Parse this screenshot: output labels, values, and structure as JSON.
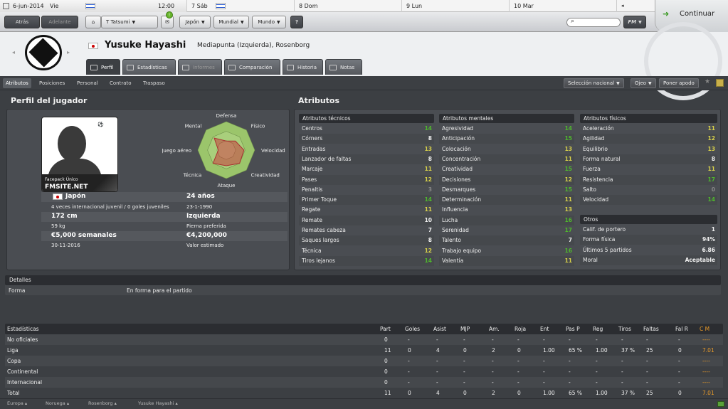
{
  "topbar": {
    "date": "6-jun-2014",
    "day": "Vie",
    "time": "12:00",
    "days": [
      "7 Sáb",
      "8 Dom",
      "9 Lun",
      "10 Mar"
    ]
  },
  "toolbar": {
    "back": "Atrás",
    "forward": "Adelante",
    "manager": "T Tatsumi",
    "japan": "Japón",
    "world_cup": "Mundial",
    "world": "Mundo",
    "help": "?",
    "continue": "Continuar",
    "fm_menu": "FM"
  },
  "player": {
    "name": "Yusuke Hayashi",
    "position_club": "Mediapunta (Izquierda), Rosenborg"
  },
  "tabs": [
    {
      "label": "Perfil",
      "state": "active"
    },
    {
      "label": "Estadísticas",
      "state": "normal"
    },
    {
      "label": "Informes",
      "state": "disabled"
    },
    {
      "label": "Comparación",
      "state": "normal"
    },
    {
      "label": "Historia",
      "state": "normal"
    },
    {
      "label": "Notas",
      "state": "normal"
    }
  ],
  "subnav": [
    "Atributos",
    "Posiciones",
    "Personal",
    "Contrato",
    "Traspaso"
  ],
  "actions": {
    "national": "Selección nacional",
    "scout": "Ojeo",
    "support": "Poner apodo"
  },
  "profile": {
    "title": "Perfil del jugador",
    "facepack_line1": "Facepack Único",
    "facepack_line2": "FMSITE.NET",
    "nation": "Japón",
    "intl": "4 veces internacional juvenil / 0 goles juveniles",
    "age": "24 años",
    "dob": "23-1-1990",
    "height": "172 cm",
    "weight": "59 kg",
    "foot": "Izquierda",
    "foot_label": "Pierna preferida",
    "wage": "€5,000 semanales",
    "contract_end": "30-11-2016",
    "value": "€4,200,000",
    "value_label": "Valor estimado",
    "radar_labels": [
      "Defensa",
      "Físico",
      "Velocidad",
      "Creatividad",
      "Ataque",
      "Técnica",
      "Juego aéreo",
      "Mental"
    ],
    "radar_values": [
      0.32,
      0.45,
      0.62,
      0.66,
      0.55,
      0.66,
      0.28,
      0.6
    ]
  },
  "attributes": {
    "title": "Atributos",
    "technical_header": "Atributos técnicos",
    "technical": [
      {
        "name": "Centros",
        "value": "14",
        "color": "green"
      },
      {
        "name": "Córners",
        "value": "8",
        "color": "white"
      },
      {
        "name": "Entradas",
        "value": "13",
        "color": "yellow"
      },
      {
        "name": "Lanzador de faltas",
        "value": "8",
        "color": "white"
      },
      {
        "name": "Marcaje",
        "value": "11",
        "color": "yellow"
      },
      {
        "name": "Pases",
        "value": "12",
        "color": "yellow"
      },
      {
        "name": "Penaltis",
        "value": "3",
        "color": "grey"
      },
      {
        "name": "Primer Toque",
        "value": "14",
        "color": "green"
      },
      {
        "name": "Regate",
        "value": "11",
        "color": "yellow"
      },
      {
        "name": "Remate",
        "value": "10",
        "color": "white"
      },
      {
        "name": "Remates cabeza",
        "value": "7",
        "color": "white"
      },
      {
        "name": "Saques largos",
        "value": "8",
        "color": "white"
      },
      {
        "name": "Técnica",
        "value": "12",
        "color": "yellow"
      },
      {
        "name": "Tiros lejanos",
        "value": "14",
        "color": "green"
      }
    ],
    "mental_header": "Atributos mentales",
    "mental": [
      {
        "name": "Agresividad",
        "value": "14",
        "color": "green"
      },
      {
        "name": "Anticipación",
        "value": "15",
        "color": "green"
      },
      {
        "name": "Colocación",
        "value": "13",
        "color": "yellow"
      },
      {
        "name": "Concentración",
        "value": "11",
        "color": "yellow"
      },
      {
        "name": "Creatividad",
        "value": "15",
        "color": "green"
      },
      {
        "name": "Decisiones",
        "value": "12",
        "color": "yellow"
      },
      {
        "name": "Desmarques",
        "value": "15",
        "color": "green"
      },
      {
        "name": "Determinación",
        "value": "11",
        "color": "yellow"
      },
      {
        "name": "Influencia",
        "value": "13",
        "color": "yellow"
      },
      {
        "name": "Lucha",
        "value": "16",
        "color": "green"
      },
      {
        "name": "Serenidad",
        "value": "17",
        "color": "green"
      },
      {
        "name": "Talento",
        "value": "7",
        "color": "white"
      },
      {
        "name": "Trabajo equipo",
        "value": "16",
        "color": "green"
      },
      {
        "name": "Valentía",
        "value": "11",
        "color": "yellow"
      }
    ],
    "physical_header": "Atributos físicos",
    "physical": [
      {
        "name": "Aceleración",
        "value": "11",
        "color": "yellow"
      },
      {
        "name": "Agilidad",
        "value": "12",
        "color": "yellow"
      },
      {
        "name": "Equilibrio",
        "value": "13",
        "color": "yellow"
      },
      {
        "name": "Forma natural",
        "value": "8",
        "color": "white"
      },
      {
        "name": "Fuerza",
        "value": "11",
        "color": "yellow"
      },
      {
        "name": "Resistencia",
        "value": "17",
        "color": "green"
      },
      {
        "name": "Salto",
        "value": "0",
        "color": "grey"
      },
      {
        "name": "Velocidad",
        "value": "14",
        "color": "green"
      }
    ],
    "other_header": "Otros",
    "other": [
      {
        "name": "Calif. de portero",
        "value": "1"
      },
      {
        "name": "Forma física",
        "value": "94%"
      },
      {
        "name": "Últimos 5 partidos",
        "value": "6.86"
      },
      {
        "name": "Moral",
        "value": "Aceptable"
      }
    ]
  },
  "details": {
    "title": "Detalles",
    "form_label": "Forma",
    "form_value": "En forma para el partido"
  },
  "stats": {
    "headers": [
      "Estadísticas",
      "Part",
      "Goles",
      "Asist",
      "MJP",
      "Am.",
      "Roja",
      "Ent",
      "Pas P",
      "Reg",
      "Tiros",
      "Faltas",
      "Fal R",
      "C M"
    ],
    "rows": [
      [
        "No oficiales",
        "0",
        "-",
        "-",
        "-",
        "-",
        "-",
        "-",
        "-",
        "-",
        "-",
        "-",
        "-",
        "----"
      ],
      [
        "Liga",
        "11",
        "0",
        "4",
        "0",
        "2",
        "0",
        "1.00",
        "65 %",
        "1.00",
        "37 %",
        "25",
        "0",
        "7.01"
      ],
      [
        "Copa",
        "0",
        "-",
        "-",
        "-",
        "-",
        "-",
        "-",
        "-",
        "-",
        "-",
        "-",
        "-",
        "----"
      ],
      [
        "Continental",
        "0",
        "-",
        "-",
        "-",
        "-",
        "-",
        "-",
        "-",
        "-",
        "-",
        "-",
        "-",
        "----"
      ],
      [
        "Internacional",
        "0",
        "-",
        "-",
        "-",
        "-",
        "-",
        "-",
        "-",
        "-",
        "-",
        "-",
        "-",
        "----"
      ],
      [
        "Total",
        "11",
        "0",
        "4",
        "0",
        "2",
        "0",
        "1.00",
        "65 %",
        "1.00",
        "37 %",
        "25",
        "0",
        "7.01"
      ]
    ]
  },
  "breadcrumbs": [
    "Europa",
    "Noruega",
    "Rosenborg",
    "Yusuke Hayashi"
  ],
  "colors": {
    "green": "#4fb82c",
    "yellow": "#d9d24a",
    "accent": "#e79a2a"
  }
}
